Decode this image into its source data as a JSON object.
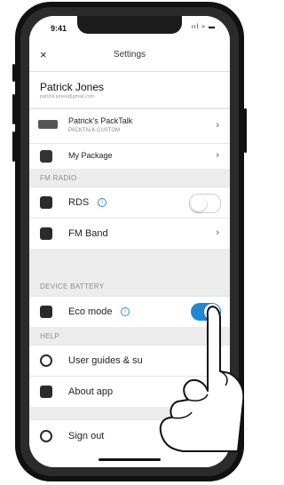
{
  "status_bar": {
    "time": "9:41",
    "indicators": "ııl ≈ ▬"
  },
  "header": {
    "close_icon": "×",
    "title": "Settings"
  },
  "profile": {
    "name": "Patrick Jones",
    "email": "patrick.jones@gmail.com"
  },
  "device": {
    "name": "Patrick's PackTalk",
    "model": "PACKTALK CUSTOM"
  },
  "package": {
    "label": "My Package"
  },
  "sections": {
    "fm_radio": "FM RADIO",
    "device_battery": "DEVICE BATTERY",
    "help": "HELP"
  },
  "fm_radio": {
    "rds_label": "RDS",
    "rds_enabled": false,
    "fm_band_label": "FM Band"
  },
  "battery": {
    "eco_label": "Eco mode",
    "eco_enabled": true
  },
  "help": {
    "guides_label": "User guides & su",
    "about_label": "About app"
  },
  "signout": {
    "label": "Sign out"
  },
  "chevron": "›",
  "info_glyph": "i",
  "colors": {
    "toggle_on": "#1e88d6",
    "accent": "#2d8fd8"
  }
}
